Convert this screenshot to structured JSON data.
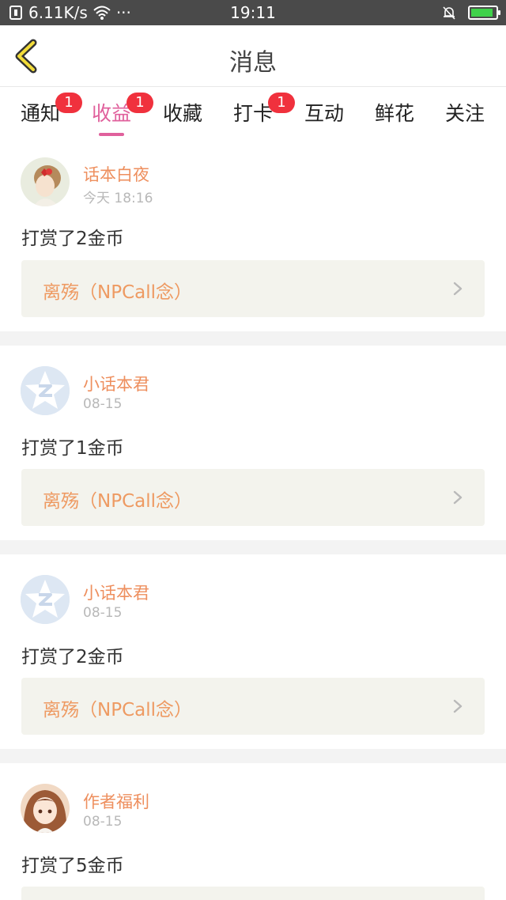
{
  "status_bar": {
    "net_speed": "6.11K/s",
    "dots": "···",
    "time": "19:11"
  },
  "header": {
    "title": "消息",
    "back_icon": "chevron-left-icon",
    "accent": "#e0609c"
  },
  "tabs": [
    {
      "label": "通知",
      "badge": "1"
    },
    {
      "label": "收益",
      "badge": "1",
      "active": true
    },
    {
      "label": "收藏"
    },
    {
      "label": "打卡",
      "badge": "1"
    },
    {
      "label": "互动"
    },
    {
      "label": "鲜花"
    },
    {
      "label": "关注"
    }
  ],
  "messages": [
    {
      "name": "话本白夜",
      "time": "今天 18:16",
      "text": "打赏了2金币",
      "link": "离殇（NPCall念）",
      "avatar": "girl-portrait"
    },
    {
      "name": "小话本君",
      "time": "08-15",
      "text": "打赏了1金币",
      "link": "离殇（NPCall念）",
      "avatar": "default-star"
    },
    {
      "name": "小话本君",
      "time": "08-15",
      "text": "打赏了2金币",
      "link": "离殇（NPCall念）",
      "avatar": "default-star"
    },
    {
      "name": "作者福利",
      "time": "08-15",
      "text": "打赏了5金币",
      "link": "",
      "avatar": "anime-girl"
    }
  ],
  "colors": {
    "name": "#ee8f5e",
    "link": "#ee9a62",
    "badge": "#f0313d",
    "link_bg": "#f3f3ed"
  }
}
